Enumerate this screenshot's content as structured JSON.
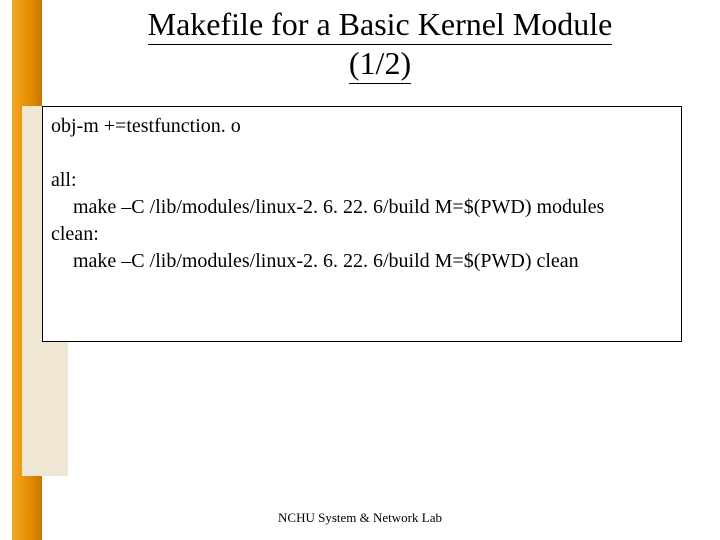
{
  "title": {
    "line1": "Makefile for a Basic Kernel Module",
    "line2": "(1/2)"
  },
  "code": {
    "l1": "obj-m +=testfunction. o",
    "l2": "all:",
    "l3": "make –C /lib/modules/linux-2. 6. 22. 6/build M=$(PWD) modules",
    "l4": "clean:",
    "l5": "make –C /lib/modules/linux-2. 6. 22. 6/build M=$(PWD) clean"
  },
  "footer": "NCHU System & Network Lab"
}
